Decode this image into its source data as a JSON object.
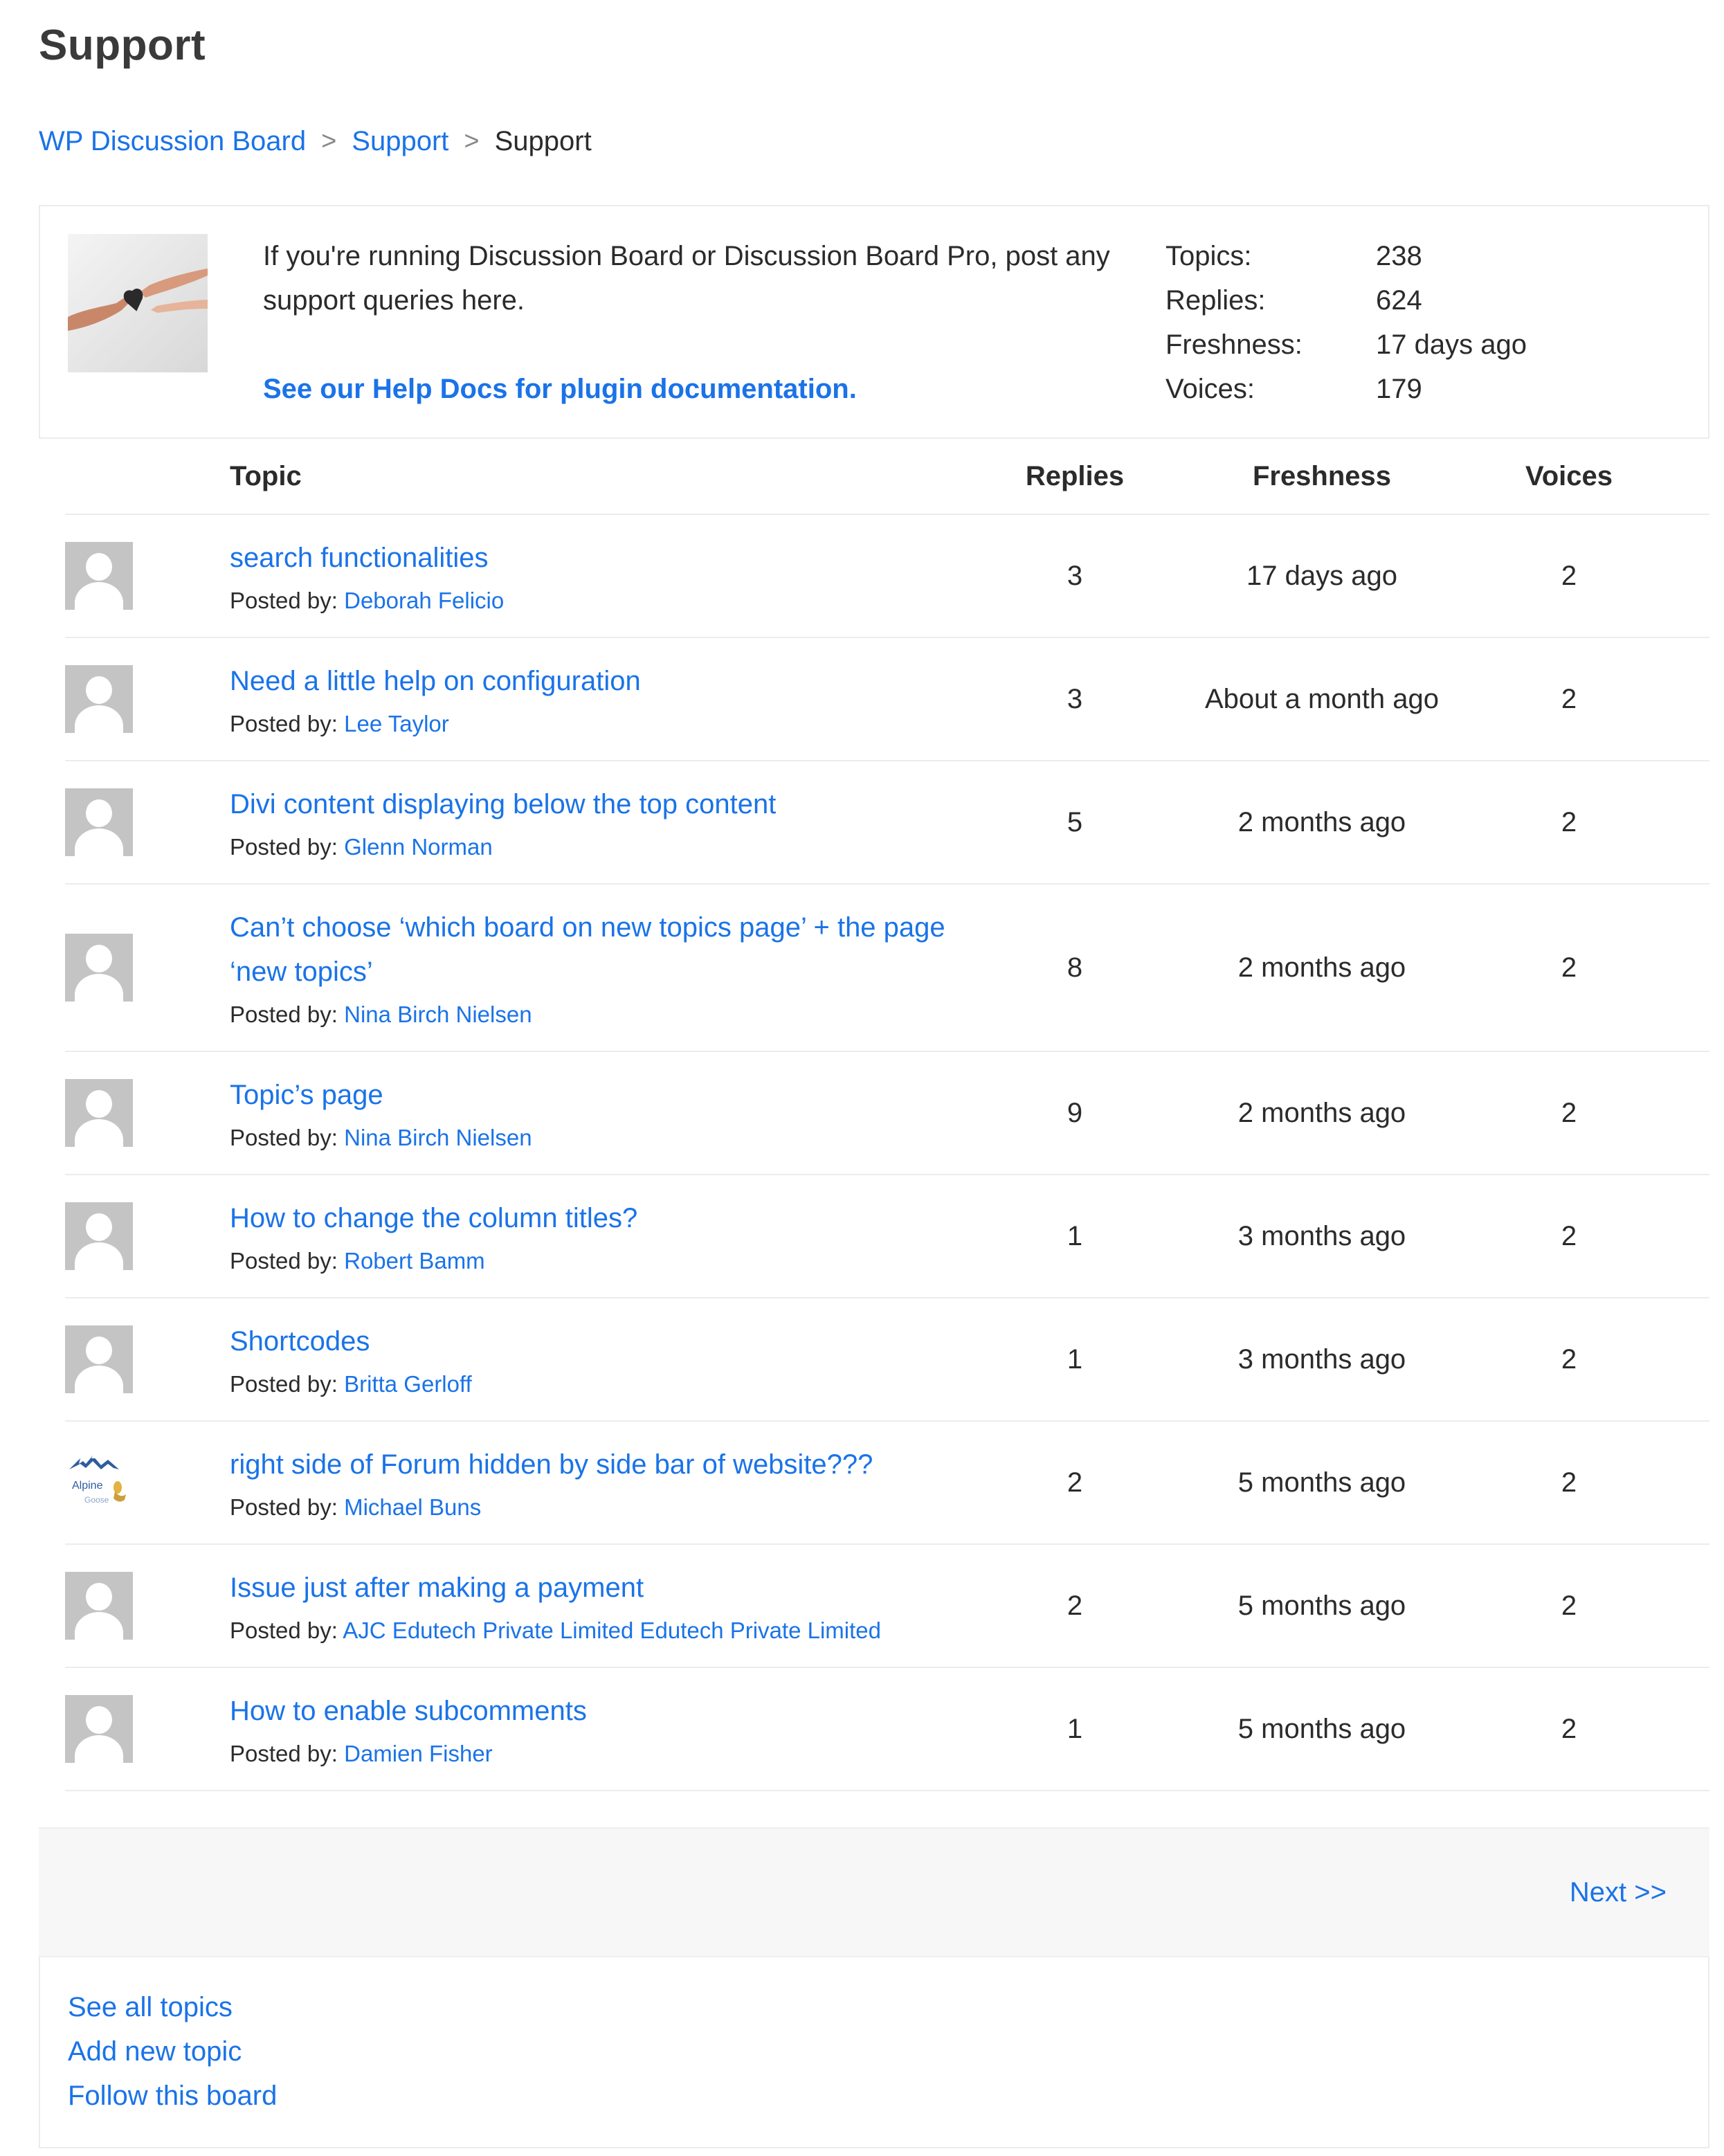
{
  "page": {
    "title": "Support"
  },
  "breadcrumb": {
    "items": [
      "WP Discussion Board",
      "Support",
      "Support"
    ],
    "separator": ">"
  },
  "board": {
    "description": "If you're running Discussion Board or Discussion Board Pro, post any support queries here.",
    "help_link": "See our Help Docs for plugin documentation.",
    "stats": [
      {
        "label": "Topics:",
        "value": "238"
      },
      {
        "label": "Replies:",
        "value": "624"
      },
      {
        "label": "Freshness:",
        "value": "17 days ago"
      },
      {
        "label": "Voices:",
        "value": "179"
      }
    ]
  },
  "table": {
    "headers": {
      "topic": "Topic",
      "replies": "Replies",
      "freshness": "Freshness",
      "voices": "Voices"
    },
    "posted_by_label": "Posted by:",
    "rows": [
      {
        "title": "search functionalities",
        "author": "Deborah Felicio",
        "replies": "3",
        "freshness": "17 days ago",
        "voices": "2"
      },
      {
        "title": "Need a little help on configuration",
        "author": "Lee Taylor",
        "replies": "3",
        "freshness": "About a month ago",
        "voices": "2"
      },
      {
        "title": "Divi content displaying below the top content",
        "author": "Glenn Norman",
        "replies": "5",
        "freshness": "2 months ago",
        "voices": "2"
      },
      {
        "title": "Can’t choose ‘which board on new topics page’ + the page ‘new topics’",
        "author": "Nina Birch Nielsen",
        "replies": "8",
        "freshness": "2 months ago",
        "voices": "2"
      },
      {
        "title": "Topic’s page",
        "author": "Nina Birch Nielsen",
        "replies": "9",
        "freshness": "2 months ago",
        "voices": "2"
      },
      {
        "title": "How to change the column titles?",
        "author": "Robert Bamm",
        "replies": "1",
        "freshness": "3 months ago",
        "voices": "2"
      },
      {
        "title": "Shortcodes",
        "author": "Britta Gerloff",
        "replies": "1",
        "freshness": "3 months ago",
        "voices": "2"
      },
      {
        "title": "right side of Forum hidden by side bar of website???",
        "author": "Michael Buns",
        "replies": "2",
        "freshness": "5 months ago",
        "voices": "2",
        "avatar_text": [
          "Alpine",
          "Goose"
        ]
      },
      {
        "title": "Issue just after making a payment",
        "author": "AJC Edutech Private Limited Edutech Private Limited",
        "replies": "2",
        "freshness": "5 months ago",
        "voices": "2"
      },
      {
        "title": "How to enable subcomments",
        "author": "Damien Fisher",
        "replies": "1",
        "freshness": "5 months ago",
        "voices": "2"
      }
    ]
  },
  "pagination": {
    "next_label": "Next >>"
  },
  "footer_links": [
    "See all topics",
    "Add new topic",
    "Follow this board"
  ],
  "colors": {
    "link": "#1a73e8",
    "text": "#2b2b2b",
    "divider": "#ececec",
    "pager_bg": "#f7f7f7"
  }
}
